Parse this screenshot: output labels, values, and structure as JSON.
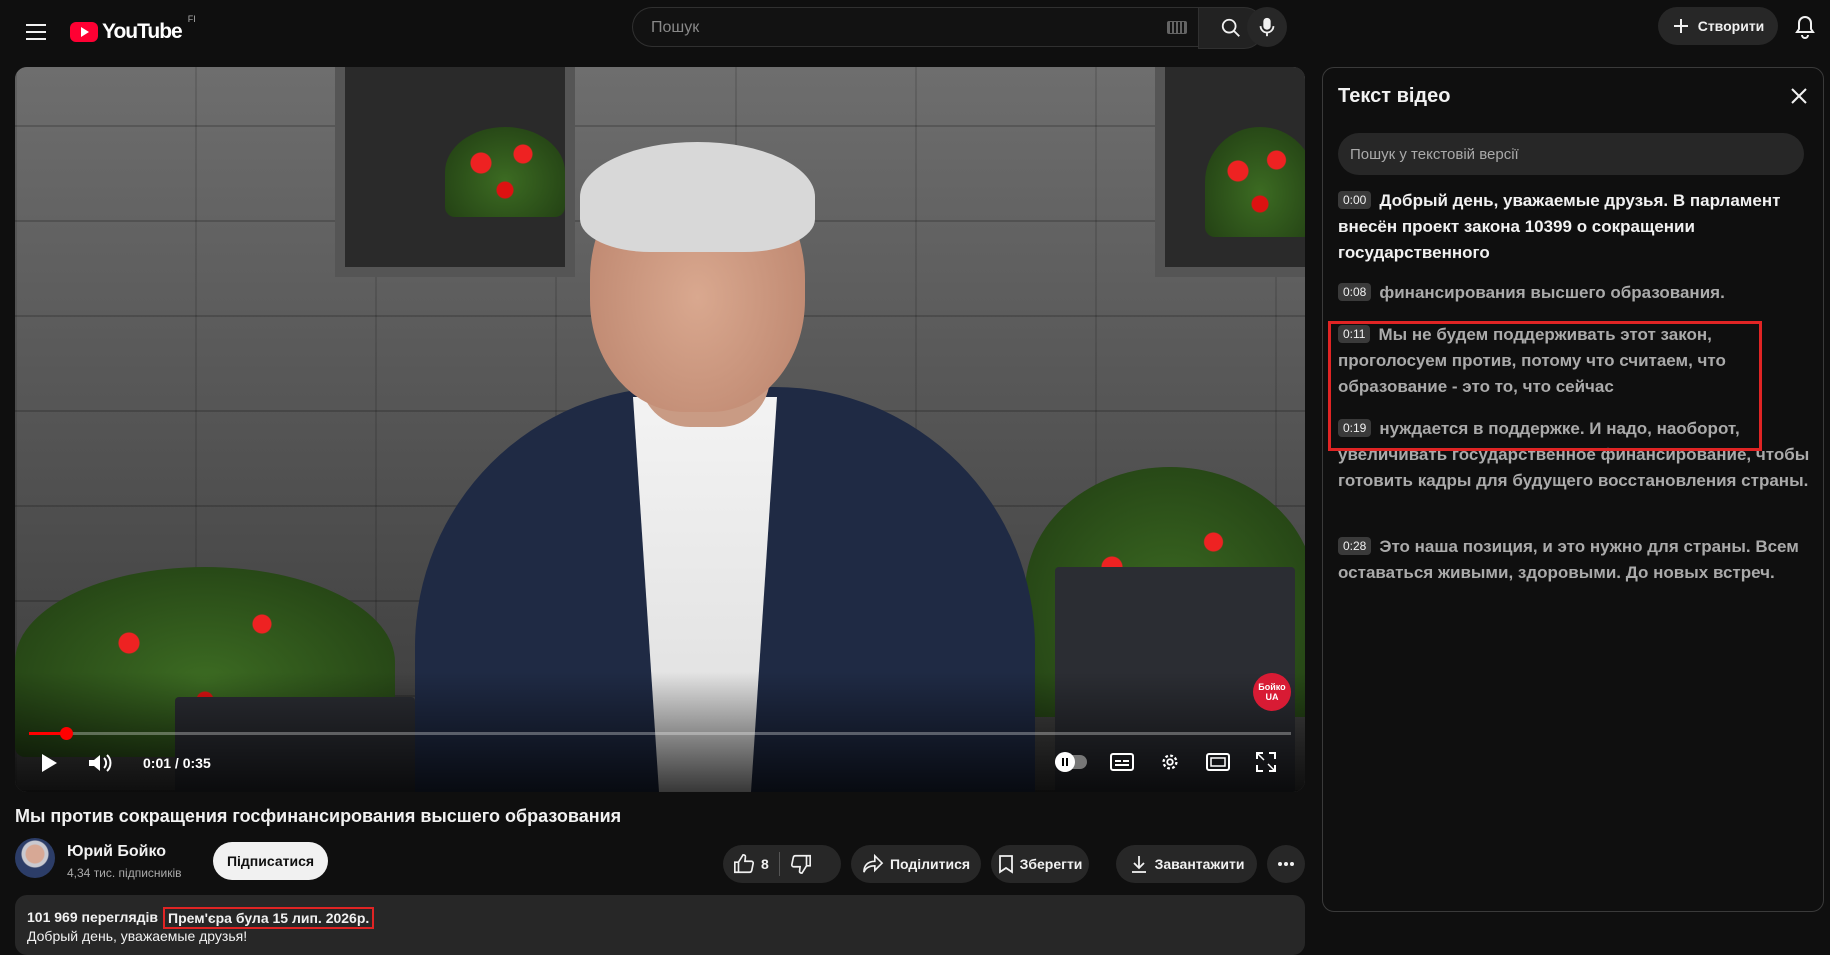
{
  "header": {
    "logo_text": "YouTube",
    "country_code": "FI",
    "search_placeholder": "Пошук",
    "create_label": "Створити"
  },
  "video": {
    "current_time": "0:01",
    "duration": "0:35",
    "progress_fraction": 0.029,
    "watermark": "Бойко UA"
  },
  "title": "Мы против сокращения госфинансирования высшего образования",
  "channel": {
    "name": "Юрий Бойко",
    "subscribers": "4,34 тис. підписників",
    "subscribe_label": "Підписатися"
  },
  "actions": {
    "likes": "8",
    "share_label": "Поділитися",
    "save_label": "Зберегти",
    "download_label": "Завантажити"
  },
  "description": {
    "views": "101 969 переглядів",
    "premiere": "Прем'єра була 15 лип. 2026р.",
    "text": "Добрый день, уважаемые друзья!"
  },
  "transcript": {
    "title": "Текст відео",
    "search_placeholder": "Пошук у текстовій версії",
    "segments": [
      {
        "time": "0:00",
        "text": "Добрый день, уважаемые друзья. В парламент внесён проект закона 10399 о сокращении государственного"
      },
      {
        "time": "0:08",
        "text": "финансирования высшего образования."
      },
      {
        "time": "0:11",
        "text": "Мы не будем поддерживать этот закон, проголосуем против, потому что считаем, что образование - это то, что сейчас"
      },
      {
        "time": "0:19",
        "text": "нуждается в поддержке. И надо, наоборот, увеличивать государственное финансирование, чтобы готовить кадры для будущего восстановления страны."
      },
      {
        "time": "0:28",
        "text": "Это наша позиция, и это нужно для страны. Всем оставаться живыми, здоровыми. До новых встреч."
      }
    ]
  },
  "colors": {
    "accent": "#ff0033",
    "highlight_box": "#e02424",
    "background": "#0f0f0f"
  }
}
